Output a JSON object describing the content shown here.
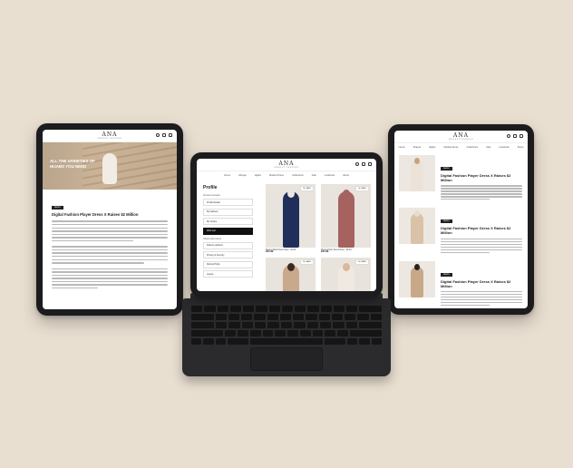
{
  "brand": {
    "logo_text": "ANA",
    "logo_sub": "MODEST FASHION"
  },
  "left_tablet": {
    "hero_headline": "ALL THE VARIETIES OF HIJABS YOU NEED",
    "article": {
      "badge": "NEWS",
      "title": "Digital Fashion Player Dress X Raises $2 Million"
    }
  },
  "center_tablet": {
    "nav": [
      "Home",
      "Abayas",
      "Hijabs",
      "Modest Dress",
      "Collections",
      "Sale",
      "Lookbook",
      "About"
    ],
    "sidebar": {
      "title": "Profile",
      "section_account": "Account overview",
      "items_account": [
        "Profile Details",
        "My Address",
        "My Orders",
        "Wish List"
      ],
      "active_item": "Wish List",
      "section_orders": "Orders and returns",
      "items_orders": [
        "Delivery address",
        "Privacy & Security",
        "Refund Policy",
        "Logout"
      ]
    },
    "products": [
      {
        "name": "Modest Maxi Dress Navy - ELSA",
        "price": "£35 £48",
        "sale": "On SALE",
        "colors": {
          "body": "#1f2f5a",
          "head": "#e9e4de"
        }
      },
      {
        "name": "Pleated Maxi Dress Rose - ELSA",
        "price": "£35 £48",
        "sale": "On SALE",
        "colors": {
          "body": "#a5625f",
          "head": "#a5625f"
        }
      },
      {
        "name": "",
        "price": "",
        "sale": "On SALE",
        "colors": {
          "body": "#c8a98c",
          "head": "#3a2a22"
        }
      },
      {
        "name": "",
        "price": "",
        "sale": "On SALE",
        "colors": {
          "body": "#efe9e1",
          "head": "#d9b89b"
        }
      }
    ]
  },
  "right_tablet": {
    "nav": [
      "Home",
      "Abayas",
      "Hijabs",
      "Modest Dress",
      "Collections",
      "Sale",
      "Lookbook",
      "About"
    ],
    "posts": [
      {
        "badge": "NEWS",
        "title": "Digital Fashion Player Dress X Raises $2 Million",
        "colors": {
          "body": "#ebe3d8",
          "head": "#c8a27d"
        }
      },
      {
        "badge": "NEWS",
        "title": "Digital Fashion Player Dress X Raises $2 Million",
        "colors": {
          "body": "#d9c2a8",
          "head": "#e8dccc"
        }
      },
      {
        "badge": "NEWS",
        "title": "Digital Fashion Player Dress X Raises $2 Million",
        "colors": {
          "body": "#c9a887",
          "head": "#2a221d"
        }
      }
    ]
  }
}
